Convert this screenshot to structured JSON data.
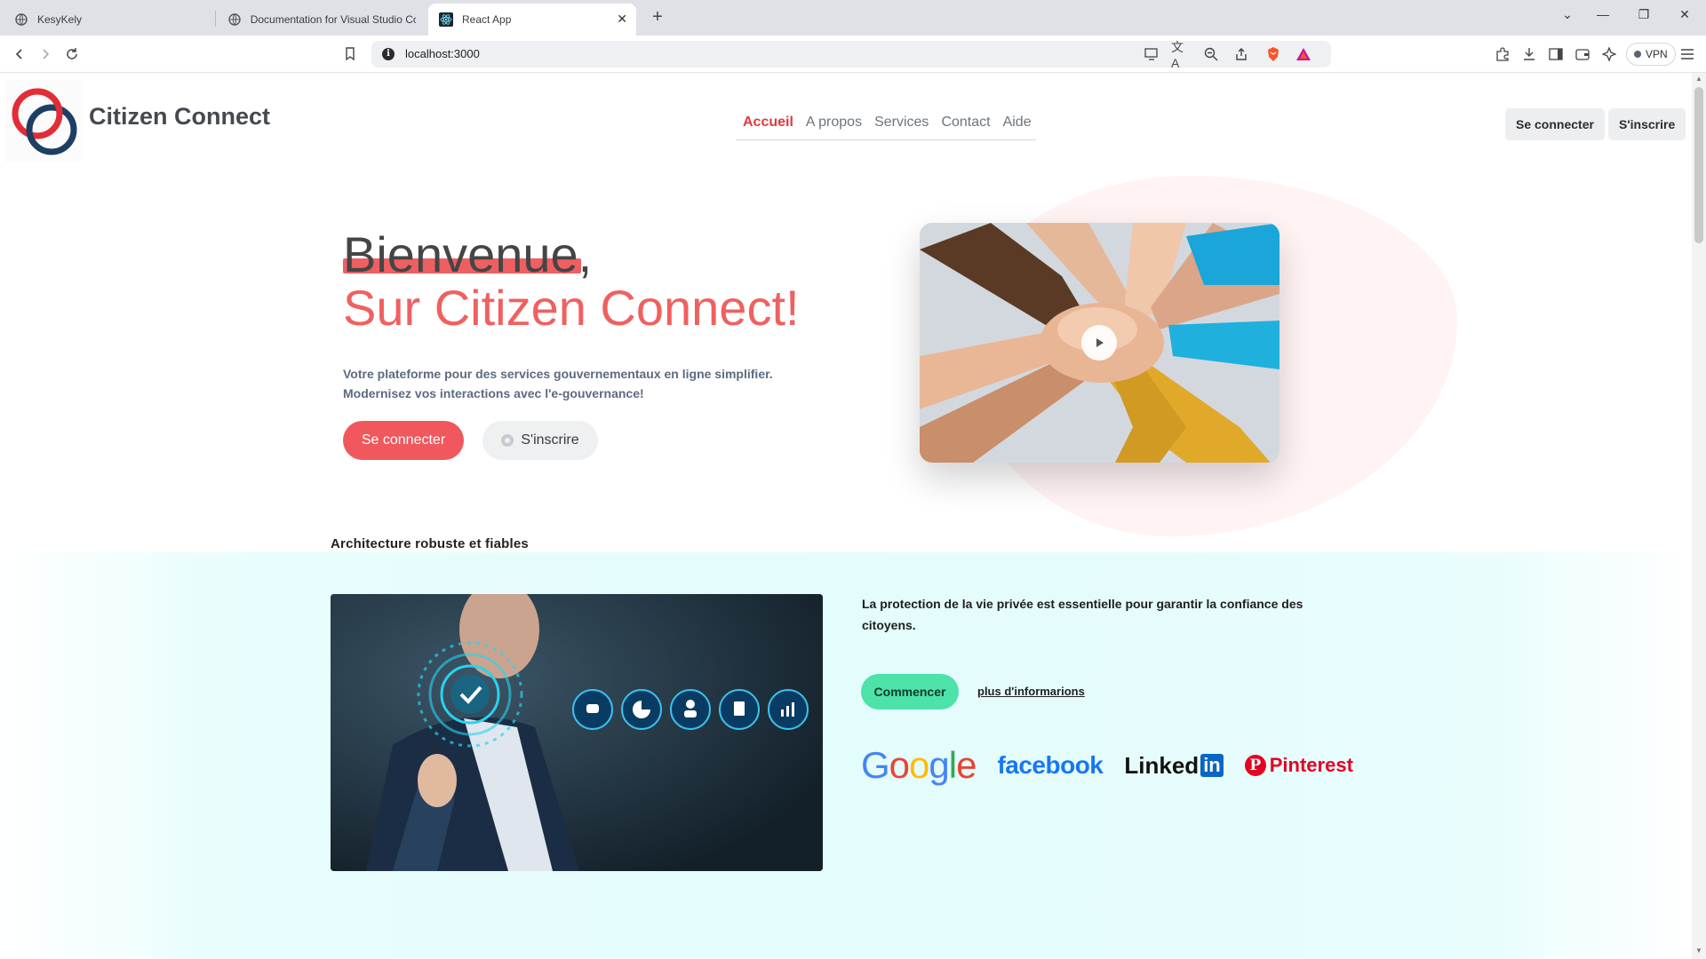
{
  "browser": {
    "tabs": [
      {
        "title": "KesyKely"
      },
      {
        "title": "Documentation for Visual Studio Co"
      },
      {
        "title": "React App"
      }
    ],
    "url": "localhost:3000",
    "vpn_label": "VPN"
  },
  "header": {
    "brand": "Citizen Connect",
    "nav": [
      "Accueil",
      "A propos",
      "Services",
      "Contact",
      "Aide"
    ],
    "login_label": "Se connecter",
    "signup_label": "S'inscrire"
  },
  "hero": {
    "title_line1": "Bienvenue,",
    "title_line2": "Sur Citizen Connect!",
    "description_line1": "Votre plateforme pour des services gouvernementaux en ligne simplifier.",
    "description_line2": "Modernisez vos interactions avec l'e-gouvernance!",
    "primary_button": "Se connecter",
    "secondary_button": "S'inscrire"
  },
  "section2": {
    "title": "Architecture robuste et fiables",
    "text": "La protection de la vie privée est essentielle pour garantir la confiance des citoyens.",
    "start_button": "Commencer",
    "more_link": "plus d'informarions",
    "partners": {
      "facebook": "facebook",
      "linkedin": "Linked",
      "linkedin_badge": "in",
      "pinterest": "Pinterest"
    }
  },
  "colors": {
    "accent": "#f0585d",
    "nav_active": "#e23b3b",
    "start_button": "#4de2a8",
    "section_bg": "#e3fcfc"
  },
  "icons": [
    "back-icon",
    "forward-icon",
    "reload-icon",
    "bookmark-icon",
    "info-icon",
    "cast-icon",
    "translate-icon",
    "zoom-icon",
    "share-icon",
    "brave-shield-icon",
    "brave-rewards-icon",
    "extensions-icon",
    "download-icon",
    "sidebar-icon",
    "wallet-icon",
    "leo-icon",
    "menu-icon",
    "play-icon"
  ]
}
